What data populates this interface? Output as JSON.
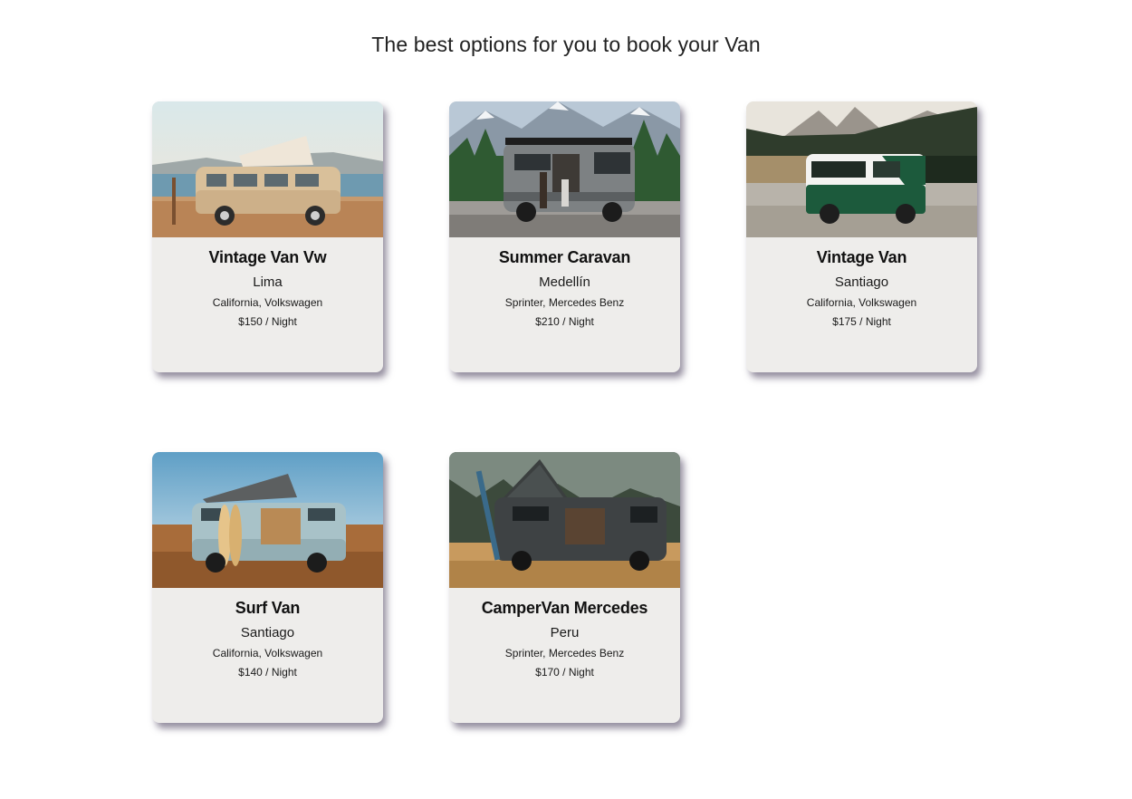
{
  "page": {
    "title": "The best options for you to book your Van"
  },
  "vans": [
    {
      "name": "Vintage Van Vw",
      "city": "Lima",
      "model": "California, Volkswagen",
      "price": "$150 / Night",
      "image": "vintage-vw-van-beach-photo"
    },
    {
      "name": "Summer Caravan",
      "city": "Medellín",
      "model": "Sprinter, Mercedes Benz",
      "price": "$210 / Night",
      "image": "sprinter-van-mountains-photo"
    },
    {
      "name": "Vintage Van",
      "city": "Santiago",
      "model": "California, Volkswagen",
      "price": "$175 / Night",
      "image": "green-vintage-van-lake-photo"
    },
    {
      "name": "Surf Van",
      "city": "Santiago",
      "model": "California, Volkswagen",
      "price": "$140 / Night",
      "image": "surf-van-desert-photo"
    },
    {
      "name": "CamperVan Mercedes",
      "city": "Peru",
      "model": "Sprinter, Mercedes Benz",
      "price": "$170 / Night",
      "image": "campervan-rooftop-tent-photo"
    }
  ]
}
